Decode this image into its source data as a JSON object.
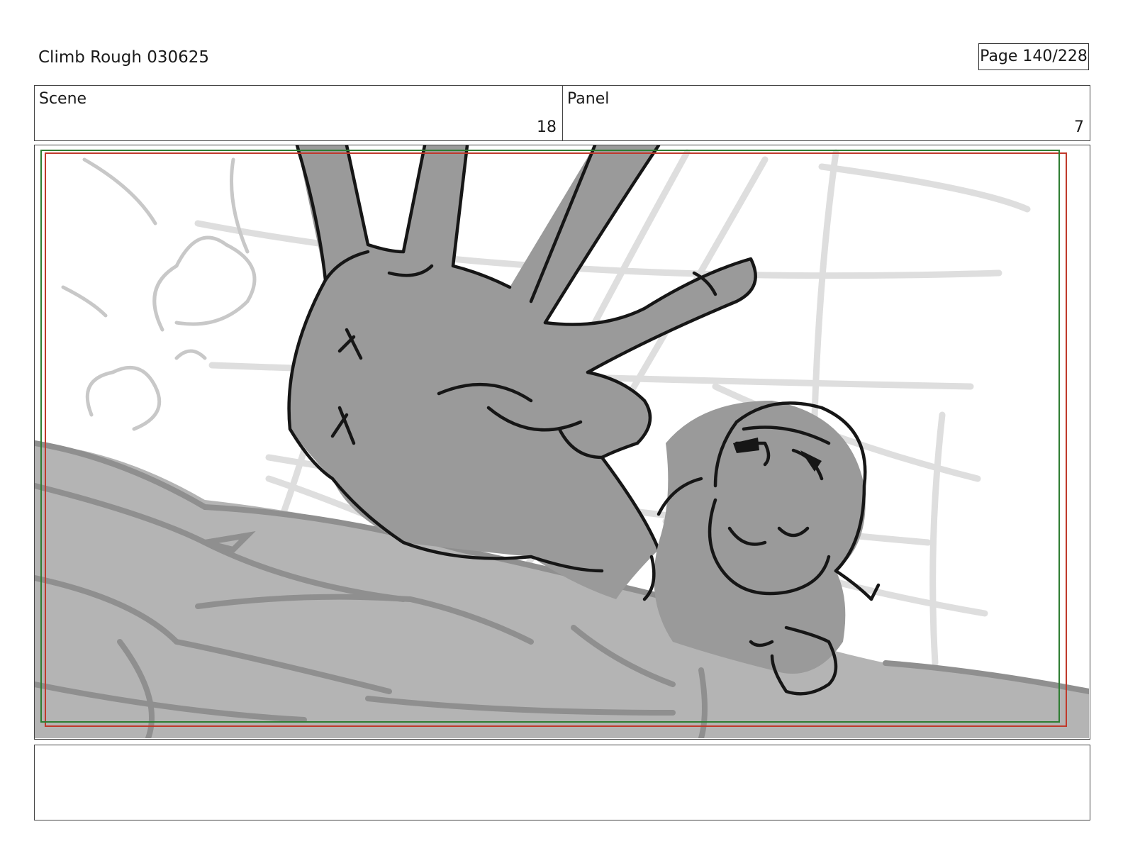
{
  "header": {
    "title": "Climb Rough 030625",
    "page": "Page 140/228"
  },
  "scene": {
    "label": "Scene",
    "value": "18"
  },
  "panel": {
    "label": "Panel",
    "value": "7"
  },
  "artwork": {
    "safe_frame_colors": {
      "outer": "#c0392b",
      "inner": "#2e7d32"
    },
    "tones": {
      "light_gray": "#b4b4b4",
      "mid_gray": "#9a9a9a",
      "sketch_gray": "#dcdcdc",
      "ink": "#161616"
    }
  },
  "notes": {
    "text": ""
  }
}
